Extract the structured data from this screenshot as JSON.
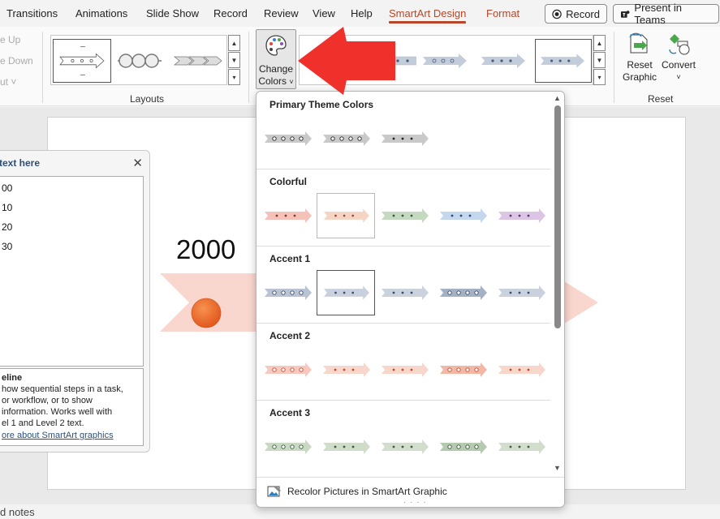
{
  "tabs": [
    "Transitions",
    "Animations",
    "Slide Show",
    "Record",
    "Review",
    "View",
    "Help",
    "SmartArt Design",
    "Format"
  ],
  "top_buttons": {
    "record": "Record",
    "present": "Present in Teams"
  },
  "ribbon": {
    "ghost_items": [
      "e Up",
      "e Down",
      "ut"
    ],
    "layouts_label": "Layouts",
    "change_colors_line1": "Change",
    "change_colors_line2": "Colors",
    "reset_graphic_line1": "Reset",
    "reset_graphic_line2": "Graphic",
    "convert": "Convert",
    "reset_label": "Reset"
  },
  "slide": {
    "year": "2000"
  },
  "notes": "d notes",
  "text_pane": {
    "title": "text here",
    "items": [
      "00",
      "10",
      "20",
      "30"
    ],
    "desc_title": "eline",
    "desc_lines": [
      "how sequential steps in a task,",
      "or workflow, or to show",
      "information. Works well with",
      "el 1 and Level 2 text."
    ],
    "link": "ore about SmartArt graphics"
  },
  "dropdown": {
    "sections": [
      {
        "title": "Primary Theme Colors"
      },
      {
        "title": "Colorful"
      },
      {
        "title": "Accent 1"
      },
      {
        "title": "Accent 2"
      },
      {
        "title": "Accent 3"
      }
    ],
    "recolor": "Recolor Pictures in SmartArt Graphic"
  },
  "colors": {
    "accent_tab": "#b7472a",
    "arrow_red": "#f0302a",
    "slide_arrow": "#f9d7ce",
    "slide_circle": "#ed6b2c"
  }
}
